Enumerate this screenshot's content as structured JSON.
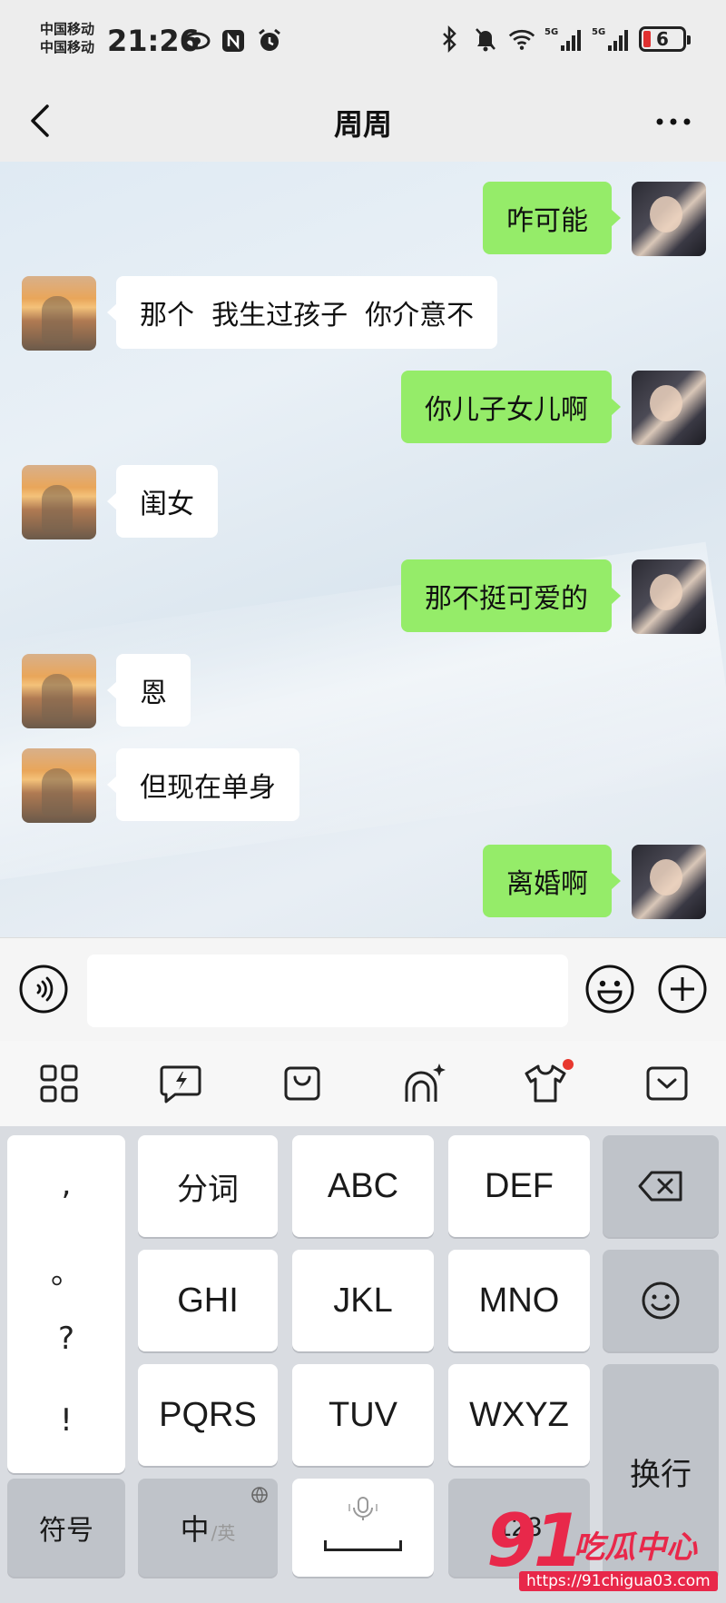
{
  "status_bar": {
    "carrier_1": "中国移动",
    "carrier_2": "中国移动",
    "time": "21:26",
    "battery_level": "6",
    "signal_1_label": "5G",
    "signal_2_label": "5G"
  },
  "nav": {
    "title": "周周"
  },
  "messages": [
    {
      "side": "right",
      "text": "咋可能"
    },
    {
      "side": "left",
      "text": "那个  我生过孩子  你介意不"
    },
    {
      "side": "right",
      "text": "你儿子女儿啊"
    },
    {
      "side": "left",
      "text": "闺女"
    },
    {
      "side": "right",
      "text": "那不挺可爱的"
    },
    {
      "side": "left",
      "text": "恩"
    },
    {
      "side": "left",
      "text": "但现在单身"
    },
    {
      "side": "right",
      "text": "离婚啊"
    }
  ],
  "input": {
    "value": ""
  },
  "keyboard": {
    "punctuation": [
      ",",
      "。",
      "?",
      "!"
    ],
    "row1": [
      "分词",
      "ABC",
      "DEF"
    ],
    "row2": [
      "GHI",
      "JKL",
      "MNO"
    ],
    "row3": [
      "PQRS",
      "TUV",
      "WXYZ"
    ],
    "symbols": "符号",
    "zh": "中",
    "zh_sub": "/英",
    "enter": "换行",
    "num": "123"
  },
  "watermark": {
    "number": "91",
    "text": "吃瓜中心",
    "url": "https://91chigua03.com"
  },
  "colors": {
    "sent_bubble": "#95ec69",
    "received_bubble": "#ffffff",
    "watermark": "#e8284a"
  }
}
